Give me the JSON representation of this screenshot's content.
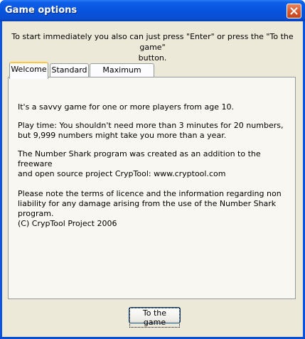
{
  "window": {
    "title": "Game options"
  },
  "intro": {
    "line1": "To start immediately you also can just press \"Enter\" or press the  \"To the game\"",
    "line2": "button."
  },
  "tabs": [
    {
      "label": "Welcome",
      "active": true
    },
    {
      "label": "Standard",
      "active": false
    },
    {
      "label": "Maximum values",
      "active": false
    }
  ],
  "welcome": {
    "p1": "It's a savvy game for one or more players from age 10.",
    "p2_l1": "Play time: You shouldn't need more than 3 minutes for 20 numbers,",
    "p2_l2": "but 9,999 numbers might take you more than a year.",
    "p3_l1": "The Number Shark program was created as an addition to the freeware",
    "p3_l2": "and open source project CrypTool: www.cryptool.com",
    "p4_l1": "Please note the terms of licence and the information regarding non",
    "p4_l2": "liability for any damage arising from the use of the Number Shark program.",
    "p4_l3": "(C) CrypTool Project 2006"
  },
  "buttons": {
    "ok_label": "To the game"
  },
  "colors": {
    "titlebar": "#0754de",
    "dialog_bg": "#ece9d8",
    "close_btn": "#d4532a",
    "tab_highlight": "#ffc83c"
  }
}
